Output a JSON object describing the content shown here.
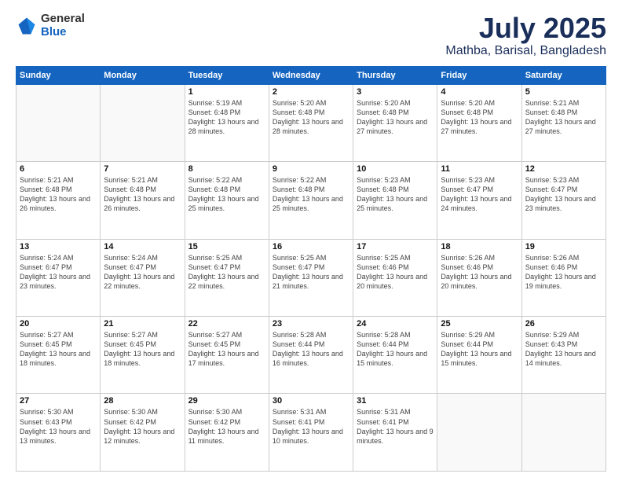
{
  "logo": {
    "general": "General",
    "blue": "Blue"
  },
  "title": {
    "month_year": "July 2025",
    "location": "Mathba, Barisal, Bangladesh"
  },
  "weekdays": [
    "Sunday",
    "Monday",
    "Tuesday",
    "Wednesday",
    "Thursday",
    "Friday",
    "Saturday"
  ],
  "days": [
    {
      "date": "",
      "sunrise": "",
      "sunset": "",
      "daylight": ""
    },
    {
      "date": "",
      "sunrise": "",
      "sunset": "",
      "daylight": ""
    },
    {
      "date": "1",
      "sunrise": "Sunrise: 5:19 AM",
      "sunset": "Sunset: 6:48 PM",
      "daylight": "Daylight: 13 hours and 28 minutes."
    },
    {
      "date": "2",
      "sunrise": "Sunrise: 5:20 AM",
      "sunset": "Sunset: 6:48 PM",
      "daylight": "Daylight: 13 hours and 28 minutes."
    },
    {
      "date": "3",
      "sunrise": "Sunrise: 5:20 AM",
      "sunset": "Sunset: 6:48 PM",
      "daylight": "Daylight: 13 hours and 27 minutes."
    },
    {
      "date": "4",
      "sunrise": "Sunrise: 5:20 AM",
      "sunset": "Sunset: 6:48 PM",
      "daylight": "Daylight: 13 hours and 27 minutes."
    },
    {
      "date": "5",
      "sunrise": "Sunrise: 5:21 AM",
      "sunset": "Sunset: 6:48 PM",
      "daylight": "Daylight: 13 hours and 27 minutes."
    },
    {
      "date": "6",
      "sunrise": "Sunrise: 5:21 AM",
      "sunset": "Sunset: 6:48 PM",
      "daylight": "Daylight: 13 hours and 26 minutes."
    },
    {
      "date": "7",
      "sunrise": "Sunrise: 5:21 AM",
      "sunset": "Sunset: 6:48 PM",
      "daylight": "Daylight: 13 hours and 26 minutes."
    },
    {
      "date": "8",
      "sunrise": "Sunrise: 5:22 AM",
      "sunset": "Sunset: 6:48 PM",
      "daylight": "Daylight: 13 hours and 25 minutes."
    },
    {
      "date": "9",
      "sunrise": "Sunrise: 5:22 AM",
      "sunset": "Sunset: 6:48 PM",
      "daylight": "Daylight: 13 hours and 25 minutes."
    },
    {
      "date": "10",
      "sunrise": "Sunrise: 5:23 AM",
      "sunset": "Sunset: 6:48 PM",
      "daylight": "Daylight: 13 hours and 25 minutes."
    },
    {
      "date": "11",
      "sunrise": "Sunrise: 5:23 AM",
      "sunset": "Sunset: 6:47 PM",
      "daylight": "Daylight: 13 hours and 24 minutes."
    },
    {
      "date": "12",
      "sunrise": "Sunrise: 5:23 AM",
      "sunset": "Sunset: 6:47 PM",
      "daylight": "Daylight: 13 hours and 23 minutes."
    },
    {
      "date": "13",
      "sunrise": "Sunrise: 5:24 AM",
      "sunset": "Sunset: 6:47 PM",
      "daylight": "Daylight: 13 hours and 23 minutes."
    },
    {
      "date": "14",
      "sunrise": "Sunrise: 5:24 AM",
      "sunset": "Sunset: 6:47 PM",
      "daylight": "Daylight: 13 hours and 22 minutes."
    },
    {
      "date": "15",
      "sunrise": "Sunrise: 5:25 AM",
      "sunset": "Sunset: 6:47 PM",
      "daylight": "Daylight: 13 hours and 22 minutes."
    },
    {
      "date": "16",
      "sunrise": "Sunrise: 5:25 AM",
      "sunset": "Sunset: 6:47 PM",
      "daylight": "Daylight: 13 hours and 21 minutes."
    },
    {
      "date": "17",
      "sunrise": "Sunrise: 5:25 AM",
      "sunset": "Sunset: 6:46 PM",
      "daylight": "Daylight: 13 hours and 20 minutes."
    },
    {
      "date": "18",
      "sunrise": "Sunrise: 5:26 AM",
      "sunset": "Sunset: 6:46 PM",
      "daylight": "Daylight: 13 hours and 20 minutes."
    },
    {
      "date": "19",
      "sunrise": "Sunrise: 5:26 AM",
      "sunset": "Sunset: 6:46 PM",
      "daylight": "Daylight: 13 hours and 19 minutes."
    },
    {
      "date": "20",
      "sunrise": "Sunrise: 5:27 AM",
      "sunset": "Sunset: 6:45 PM",
      "daylight": "Daylight: 13 hours and 18 minutes."
    },
    {
      "date": "21",
      "sunrise": "Sunrise: 5:27 AM",
      "sunset": "Sunset: 6:45 PM",
      "daylight": "Daylight: 13 hours and 18 minutes."
    },
    {
      "date": "22",
      "sunrise": "Sunrise: 5:27 AM",
      "sunset": "Sunset: 6:45 PM",
      "daylight": "Daylight: 13 hours and 17 minutes."
    },
    {
      "date": "23",
      "sunrise": "Sunrise: 5:28 AM",
      "sunset": "Sunset: 6:44 PM",
      "daylight": "Daylight: 13 hours and 16 minutes."
    },
    {
      "date": "24",
      "sunrise": "Sunrise: 5:28 AM",
      "sunset": "Sunset: 6:44 PM",
      "daylight": "Daylight: 13 hours and 15 minutes."
    },
    {
      "date": "25",
      "sunrise": "Sunrise: 5:29 AM",
      "sunset": "Sunset: 6:44 PM",
      "daylight": "Daylight: 13 hours and 15 minutes."
    },
    {
      "date": "26",
      "sunrise": "Sunrise: 5:29 AM",
      "sunset": "Sunset: 6:43 PM",
      "daylight": "Daylight: 13 hours and 14 minutes."
    },
    {
      "date": "27",
      "sunrise": "Sunrise: 5:30 AM",
      "sunset": "Sunset: 6:43 PM",
      "daylight": "Daylight: 13 hours and 13 minutes."
    },
    {
      "date": "28",
      "sunrise": "Sunrise: 5:30 AM",
      "sunset": "Sunset: 6:42 PM",
      "daylight": "Daylight: 13 hours and 12 minutes."
    },
    {
      "date": "29",
      "sunrise": "Sunrise: 5:30 AM",
      "sunset": "Sunset: 6:42 PM",
      "daylight": "Daylight: 13 hours and 11 minutes."
    },
    {
      "date": "30",
      "sunrise": "Sunrise: 5:31 AM",
      "sunset": "Sunset: 6:41 PM",
      "daylight": "Daylight: 13 hours and 10 minutes."
    },
    {
      "date": "31",
      "sunrise": "Sunrise: 5:31 AM",
      "sunset": "Sunset: 6:41 PM",
      "daylight": "Daylight: 13 hours and 9 minutes."
    },
    {
      "date": "",
      "sunrise": "",
      "sunset": "",
      "daylight": ""
    },
    {
      "date": "",
      "sunrise": "",
      "sunset": "",
      "daylight": ""
    },
    {
      "date": "",
      "sunrise": "",
      "sunset": "",
      "daylight": ""
    },
    {
      "date": "",
      "sunrise": "",
      "sunset": "",
      "daylight": ""
    },
    {
      "date": "",
      "sunrise": "",
      "sunset": "",
      "daylight": ""
    }
  ]
}
